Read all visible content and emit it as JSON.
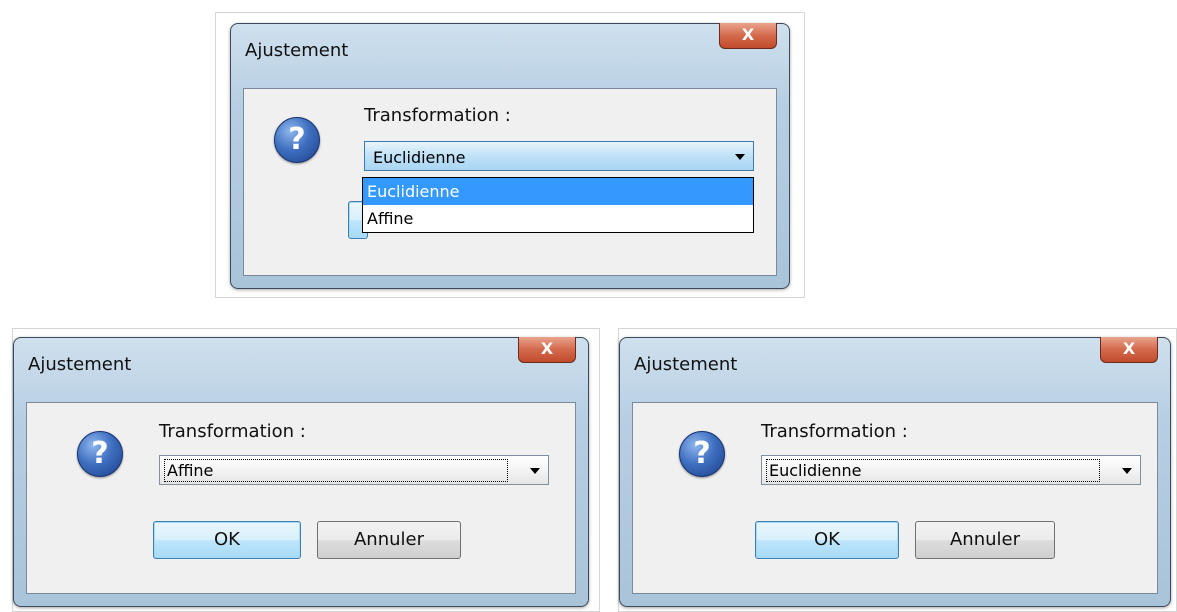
{
  "dialogs": [
    {
      "title": "Ajustement",
      "close_label": "X",
      "icon": "question-icon",
      "icon_glyph": "?",
      "field_label": "Transformation :",
      "selected": "Euclidienne",
      "dropdown_open": true,
      "options": [
        {
          "label": "Euclidienne",
          "highlighted": true
        },
        {
          "label": "Affine",
          "highlighted": false
        }
      ]
    },
    {
      "title": "Ajustement",
      "close_label": "X",
      "icon": "question-icon",
      "icon_glyph": "?",
      "field_label": "Transformation :",
      "selected": "Affine",
      "dropdown_open": false,
      "ok_label": "OK",
      "cancel_label": "Annuler"
    },
    {
      "title": "Ajustement",
      "close_label": "X",
      "icon": "question-icon",
      "icon_glyph": "?",
      "field_label": "Transformation :",
      "selected": "Euclidienne",
      "dropdown_open": false,
      "ok_label": "OK",
      "cancel_label": "Annuler"
    }
  ],
  "colors": {
    "selection": "#3399ff",
    "close_button": "#d46a4c",
    "icon_blue": "#3f6fc0"
  }
}
